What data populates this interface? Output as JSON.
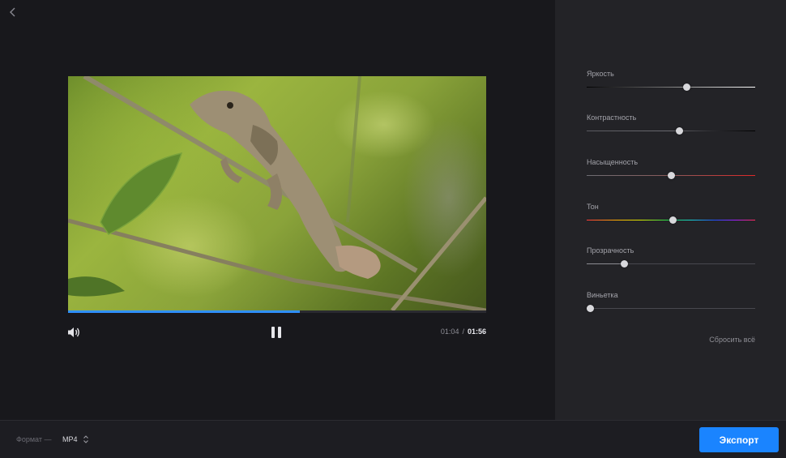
{
  "player": {
    "progress_fraction": 0.555,
    "current_time": "01:04",
    "separator": "/",
    "total_time": "01:56"
  },
  "adjustments": [
    {
      "label": "Яркость",
      "value": 0.59,
      "track": "linear-gradient(90deg,#000000,#ffffff)"
    },
    {
      "label": "Контрастность",
      "value": 0.55,
      "track": "linear-gradient(90deg,#5a5a60 0%,#6a6a70 50%,#2a2a2e 75%,#000000 100%)"
    },
    {
      "label": "Насыщенность",
      "value": 0.5,
      "track": "linear-gradient(90deg,#6d6d73 0%,#8a5a5a 50%,#e02828 100%)"
    },
    {
      "label": "Тон",
      "value": 0.51,
      "track": "linear-gradient(90deg,#ff3a3a 0%,#ffb000 18%,#d8e800 32%,#22d84a 48%,#18d0d0 62%,#2050ff 76%,#a020ff 88%,#ff2a5a 100%)"
    },
    {
      "label": "Прозрачность",
      "value": 0.22,
      "track": "linear-gradient(90deg,#8b8b92 0%,#8b8b92 22%,#48484f 22%,#48484f 100%)"
    },
    {
      "label": "Виньетка",
      "value": 0.02,
      "track": "#48484f"
    }
  ],
  "reset_label": "Сбросить всё",
  "footer": {
    "format_label": "Формат —",
    "format_value": "MP4",
    "export_label": "Экспорт"
  },
  "colors": {
    "accent": "#1a84ff",
    "progress": "#2f8fff"
  },
  "icons": [
    "back-chevron-icon",
    "volume-icon",
    "pause-icon",
    "updown-arrows-icon"
  ]
}
